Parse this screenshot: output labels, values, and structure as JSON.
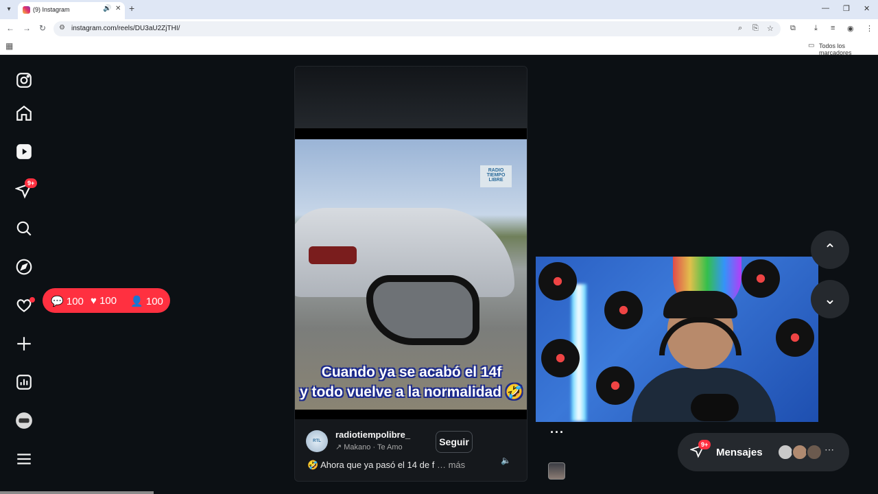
{
  "browser": {
    "tab_title": "(9) Instagram",
    "url": "instagram.com/reels/DU3aU2ZjTHI/",
    "bookmarks_label": "Todos los marcadores"
  },
  "sidebar": {
    "notifications_badge": "9+"
  },
  "activity_pill": {
    "comments": "100",
    "likes": "100",
    "followers": "100"
  },
  "reel": {
    "overlay_logo": "RADIO TIEMPO LIBRE",
    "caption_line1": "Cuando ya se acabó el 14f",
    "caption_line2": "y todo vuelve a la normalidad 🤣",
    "username": "radiotiempolibre_",
    "audio": "↗ Makano · Te Amo",
    "follow_label": "Seguir",
    "description": "🤣 Ahora que ya pasó el 14 de f",
    "more_label": "… más"
  },
  "messages": {
    "label": "Mensajes",
    "badge": "9+"
  },
  "colors": {
    "background": "#0c1014",
    "accent_red": "#ff3040",
    "panel": "#25292e"
  }
}
